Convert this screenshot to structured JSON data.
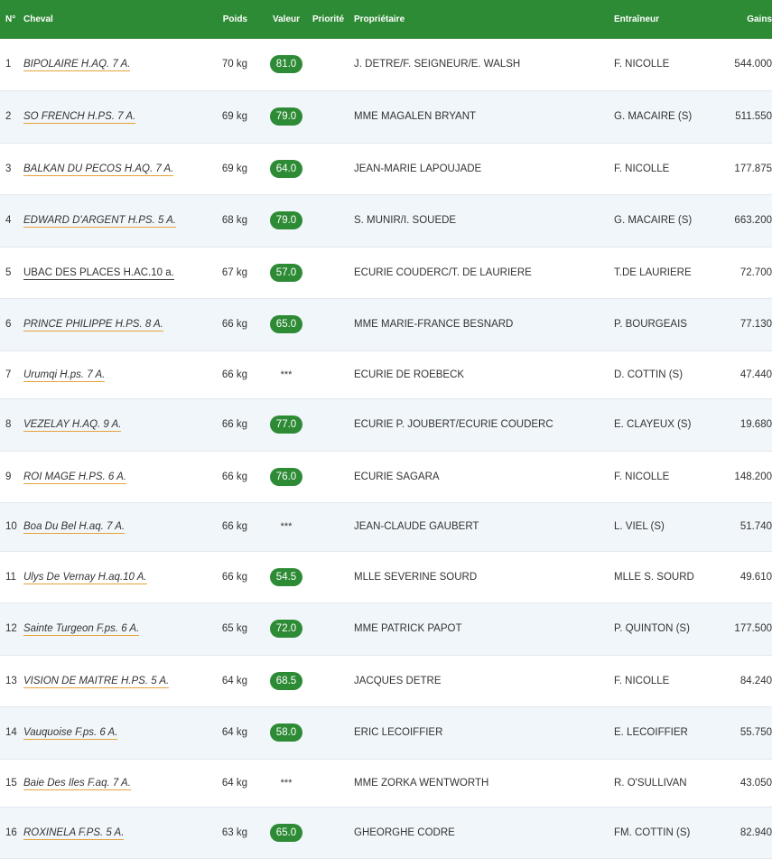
{
  "header": {
    "num": "N°",
    "horse": "Cheval",
    "poids": "Poids",
    "valeur": "Valeur",
    "priorite": "Priorité",
    "owner": "Propriétaire",
    "trainer": "Entraîneur",
    "gains": "Gains"
  },
  "colors": {
    "header_bg": "#2e8b35",
    "badge_bg": "#2e8b35",
    "underline": "#e6a23c",
    "row_alt": "#f1f6fa"
  },
  "rows": [
    {
      "num": "1",
      "horse": "BIPOLAIRE H.AQ. 7 A.",
      "poids": "70 kg",
      "valeur": "81.0",
      "owner": "J. DETRE/F. SEIGNEUR/E. WALSH",
      "trainer": "F. NICOLLE",
      "gains": "544.000",
      "h": 57
    },
    {
      "num": "2",
      "horse": "SO FRENCH H.PS. 7 A.",
      "poids": "69 kg",
      "valeur": "79.0",
      "owner": "MME MAGALEN BRYANT",
      "trainer": "G. MACAIRE (S)",
      "gains": "511.550",
      "h": 58
    },
    {
      "num": "3",
      "horse": "BALKAN DU PECOS H.AQ. 7 A.",
      "poids": "69 kg",
      "valeur": "64.0",
      "owner": "JEAN-MARIE LAPOUJADE",
      "trainer": "F. NICOLLE",
      "gains": "177.875",
      "h": 57
    },
    {
      "num": "4",
      "horse": "EDWARD D'ARGENT H.PS. 5 A.",
      "poids": "68 kg",
      "valeur": "79.0",
      "owner": "S. MUNIR/I. SOUEDE",
      "trainer": "G. MACAIRE (S)",
      "gains": "663.200",
      "h": 58
    },
    {
      "num": "5",
      "horse": "UBAC DES PLACES H.AC.10 a.",
      "poids": "67 kg",
      "valeur": "57.0",
      "owner": "ECURIE COUDERC/T. DE LAURIERE",
      "trainer": "T.DE LAURIERE",
      "gains": "72.700",
      "h": 57,
      "upright": true
    },
    {
      "num": "6",
      "horse": "PRINCE PHILIPPE H.PS. 8 A.",
      "poids": "66 kg",
      "valeur": "65.0",
      "owner": "MME MARIE-FRANCE BESNARD",
      "trainer": "P. BOURGEAIS",
      "gains": "77.130",
      "h": 58
    },
    {
      "num": "7",
      "horse": "Urumqi H.ps. 7 A.",
      "poids": "66 kg",
      "valeur": "***",
      "owner": "ECURIE DE ROEBECK",
      "trainer": "D. COTTIN (S)",
      "gains": "47.440",
      "h": 53
    },
    {
      "num": "8",
      "horse": "VEZELAY H.AQ. 9 A.",
      "poids": "66 kg",
      "valeur": "77.0",
      "owner": "ECURIE P. JOUBERT/ECURIE COUDERC",
      "trainer": "E. CLAYEUX (S)",
      "gains": "19.680",
      "h": 58
    },
    {
      "num": "9",
      "horse": "ROI MAGE H.PS. 6 A.",
      "poids": "66 kg",
      "valeur": "76.0",
      "owner": "ECURIE SAGARA",
      "trainer": "F. NICOLLE",
      "gains": "148.200",
      "h": 57
    },
    {
      "num": "10",
      "horse": "Boa Du Bel H.aq. 7 A.",
      "poids": "66 kg",
      "valeur": "***",
      "owner": "JEAN-CLAUDE GAUBERT",
      "trainer": "L. VIEL (S)",
      "gains": "51.740",
      "h": 54
    },
    {
      "num": "11",
      "horse": "Ulys De Vernay H.aq.10 A.",
      "poids": "66 kg",
      "valeur": "54.5",
      "owner": "MLLE SEVERINE SOURD",
      "trainer": "MLLE S. SOURD",
      "gains": "49.610",
      "h": 57
    },
    {
      "num": "12",
      "horse": "Sainte Turgeon F.ps. 6 A.",
      "poids": "65 kg",
      "valeur": "72.0",
      "owner": "MME PATRICK PAPOT",
      "trainer": "P. QUINTON (S)",
      "gains": "177.500",
      "h": 58
    },
    {
      "num": "13",
      "horse": "VISION DE MAITRE H.PS. 5 A.",
      "poids": "64 kg",
      "valeur": "68.5",
      "owner": "JACQUES DETRE",
      "trainer": "F. NICOLLE",
      "gains": "84.240",
      "h": 57
    },
    {
      "num": "14",
      "horse": "Vauquoise F.ps. 6 A.",
      "poids": "64 kg",
      "valeur": "58.0",
      "owner": "ERIC LECOIFFIER",
      "trainer": "E. LECOIFFIER",
      "gains": "55.750",
      "h": 58
    },
    {
      "num": "15",
      "horse": "Baie Des Iles F.aq. 7 A.",
      "poids": "64 kg",
      "valeur": "***",
      "owner": "MME ZORKA WENTWORTH",
      "trainer": "R. O'SULLIVAN",
      "gains": "43.050",
      "h": 53
    },
    {
      "num": "16",
      "horse": "ROXINELA F.PS. 5 A.",
      "poids": "63 kg",
      "valeur": "65.0",
      "owner": "GHEORGHE CODRE",
      "trainer": "FM. COTTIN (S)",
      "gains": "82.940",
      "h": 57
    }
  ]
}
